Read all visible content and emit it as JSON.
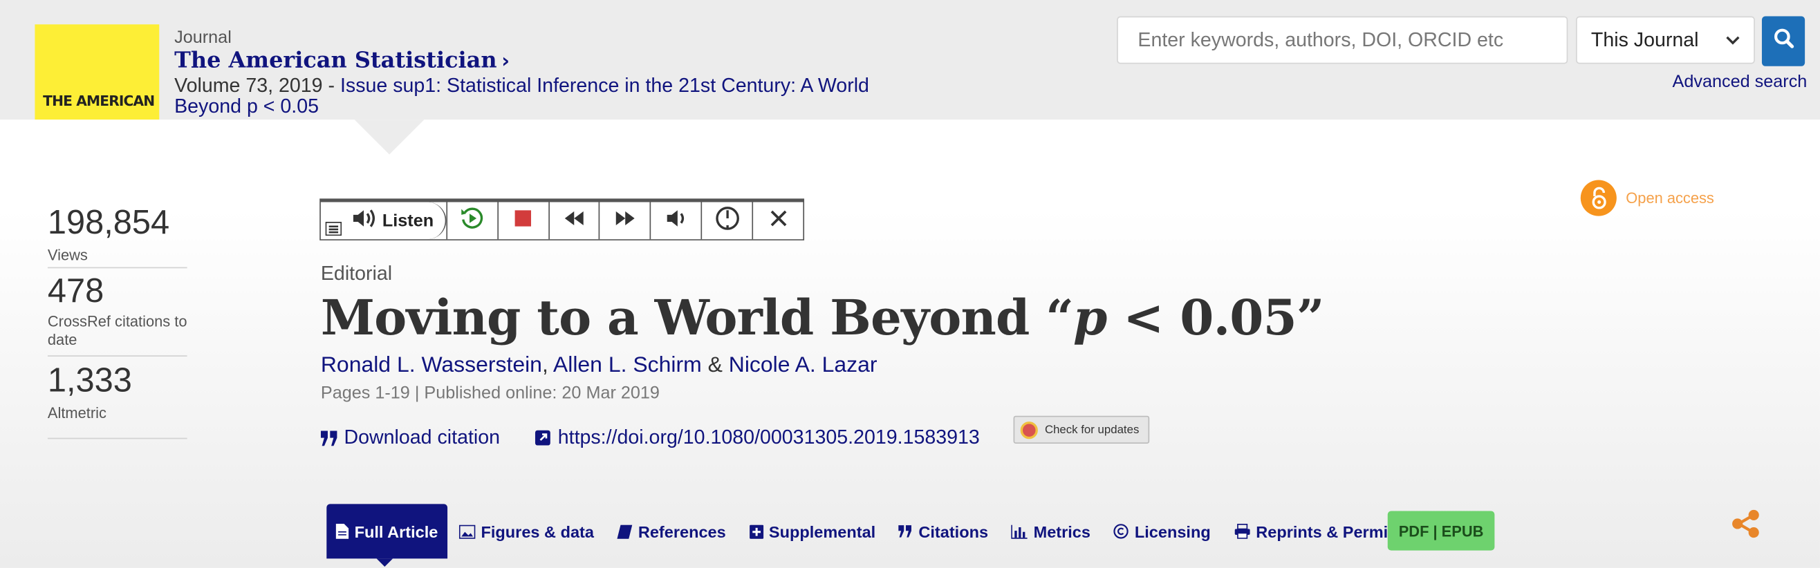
{
  "header": {
    "journal_label": "Journal",
    "journal_title": "The American Statistician",
    "cover_text": "THE AMERICAN",
    "volume": "Volume 73, 2019 - ",
    "issue": "Issue sup1: Statistical Inference in the 21st Century: A World Beyond p < 0.05"
  },
  "search": {
    "placeholder": "Enter keywords, authors, DOI, ORCID etc",
    "scope": "This Journal",
    "advanced_label": "Advanced search"
  },
  "metrics": [
    {
      "value": "198,854",
      "label": "Views"
    },
    {
      "value": "478",
      "label": "CrossRef citations to date"
    },
    {
      "value": "1,333",
      "label": "Altmetric"
    }
  ],
  "listen": {
    "label": "Listen"
  },
  "article": {
    "type": "Editorial",
    "title_before": "Moving to a World Beyond “",
    "title_p": "p",
    "title_after": " < 0.05”",
    "authors": [
      "Ronald L. Wasserstein",
      "Allen L. Schirm",
      "Nicole A. Lazar"
    ],
    "separator": ",",
    "amp": "&",
    "pub_line": "Pages 1-19 | Published online: 20 Mar 2019",
    "download_citation": "Download citation",
    "doi": "https://doi.org/10.1080/00031305.2019.1583913",
    "check_updates": "Check for updates",
    "open_access": "Open access"
  },
  "tabs": [
    {
      "label": "Full Article",
      "icon": "document-icon"
    },
    {
      "label": "Figures & data",
      "icon": "image-icon"
    },
    {
      "label": "References",
      "icon": "book-icon"
    },
    {
      "label": "Supplemental",
      "icon": "plus-square-icon"
    },
    {
      "label": "Citations",
      "icon": "quote-icon"
    },
    {
      "label": "Metrics",
      "icon": "bar-chart-icon"
    },
    {
      "label": "Licensing",
      "icon": "copyright-icon"
    },
    {
      "label": "Reprints & Permissions",
      "icon": "printer-icon"
    }
  ],
  "pdf_tab": "PDF | EPUB",
  "colors": {
    "navy": "#10147e",
    "accent_blue": "#1d6fb8",
    "open_access": "#f7941d",
    "pdf_green": "#6ed26e",
    "cover_yellow": "#fdee36"
  }
}
